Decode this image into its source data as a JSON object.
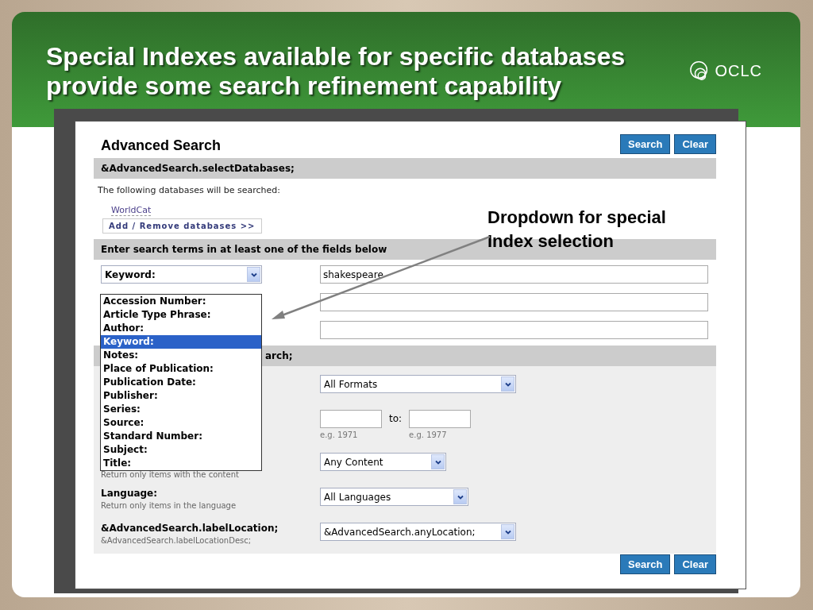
{
  "slide": {
    "title_lines": [
      "Special Indexes available for specific databases",
      "provide some search refinement capability"
    ],
    "logo": {
      "text": "OCLC"
    },
    "annotation": {
      "text_lines": [
        "Dropdown for special",
        "Index selection"
      ]
    }
  },
  "advanced_search": {
    "title": "Advanced Search",
    "top_buttons": [
      "Search",
      "Clear"
    ],
    "databases_section": {
      "header": "&AdvancedSearch.selectDatabases;",
      "intro": "The following databases will be searched:",
      "databases": [
        "WorldCat"
      ],
      "add_remove_button": "Add / Remove databases >>"
    },
    "terms_section": {
      "header": "Enter search terms in at least one of the fields below",
      "rows": [
        {
          "index": "Keyword:",
          "value": "shakespeare"
        },
        {
          "value": ""
        },
        {
          "value": ""
        }
      ],
      "index_dropdown": {
        "options": [
          {
            "label": "Accession Number:",
            "selected": false
          },
          {
            "label": "Article Type Phrase:",
            "selected": false
          },
          {
            "label": "Author:",
            "selected": false
          },
          {
            "label": "Keyword:",
            "selected": true
          },
          {
            "label": "Notes:",
            "selected": false
          },
          {
            "label": "Place of Publication:",
            "selected": false
          },
          {
            "label": "Publication Date:",
            "selected": false
          },
          {
            "label": "Publisher:",
            "selected": false
          },
          {
            "label": "Series:",
            "selected": false
          },
          {
            "label": "Source:",
            "selected": false
          },
          {
            "label": "Standard Number:",
            "selected": false
          },
          {
            "label": "Subject:",
            "selected": false
          },
          {
            "label": "Title:",
            "selected": false
          }
        ]
      }
    },
    "limits_section": {
      "header": "arch;",
      "rows": [
        {
          "kind": "select",
          "value": "All Formats"
        },
        {
          "kind": "range",
          "to_label": "to:",
          "from_hint": "e.g. 1971",
          "to_hint": "e.g. 1977"
        },
        {
          "kind": "select",
          "description": "Return only items with the content",
          "value": "Any Content"
        },
        {
          "kind": "select",
          "label": "Language:",
          "description": "Return only items in the language",
          "value": "All Languages"
        },
        {
          "kind": "select",
          "label": "&AdvancedSearch.labelLocation;",
          "description": "&AdvancedSearch.labelLocationDesc;",
          "value": "&AdvancedSearch.anyLocation;"
        }
      ]
    },
    "bottom_buttons": [
      "Search",
      "Clear"
    ]
  }
}
